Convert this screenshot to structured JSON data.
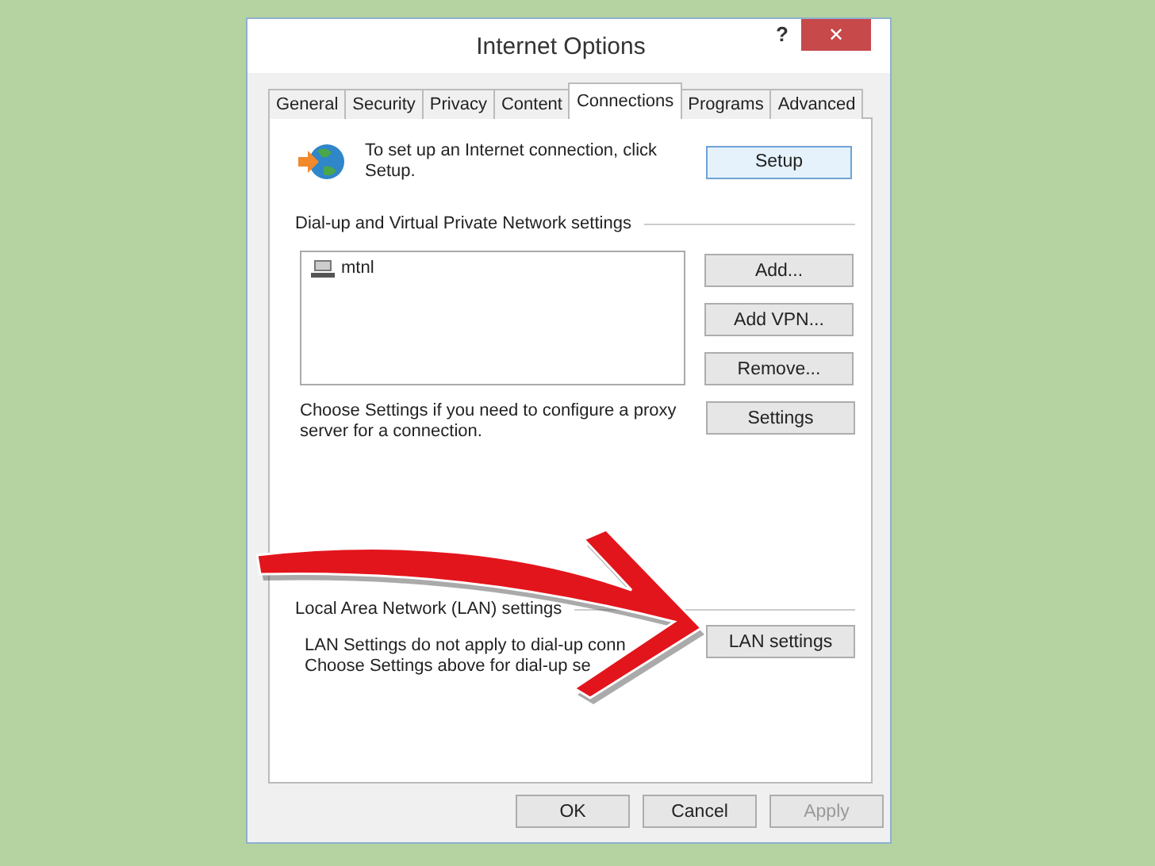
{
  "window": {
    "title": "Internet Options",
    "help": "?",
    "close": "✕"
  },
  "tabs": [
    {
      "label": "General",
      "selected": false
    },
    {
      "label": "Security",
      "selected": false
    },
    {
      "label": "Privacy",
      "selected": false
    },
    {
      "label": "Content",
      "selected": false
    },
    {
      "label": "Connections",
      "selected": true
    },
    {
      "label": "Programs",
      "selected": false
    },
    {
      "label": "Advanced",
      "selected": false
    }
  ],
  "setup": {
    "text": "To set up an Internet connection, click Setup.",
    "button": "Setup"
  },
  "dialup": {
    "heading": "Dial-up and Virtual Private Network settings",
    "connections": [
      {
        "name": "mtnl",
        "selected": false
      }
    ],
    "buttons": [
      "Add...",
      "Add VPN...",
      "Remove..."
    ],
    "proxy_text": "Choose Settings if you need to configure a proxy server for a connection.",
    "proxy_button": "Settings"
  },
  "lan": {
    "heading": "Local Area Network (LAN) settings",
    "lines": [
      "LAN Settings do not apply to dial-up conn",
      "Choose Settings above for dial-up se"
    ],
    "button": "LAN settings"
  },
  "footer": [
    {
      "label": "OK",
      "disabled": false
    },
    {
      "label": "Cancel",
      "disabled": false
    },
    {
      "label": "Apply",
      "disabled": true
    }
  ]
}
